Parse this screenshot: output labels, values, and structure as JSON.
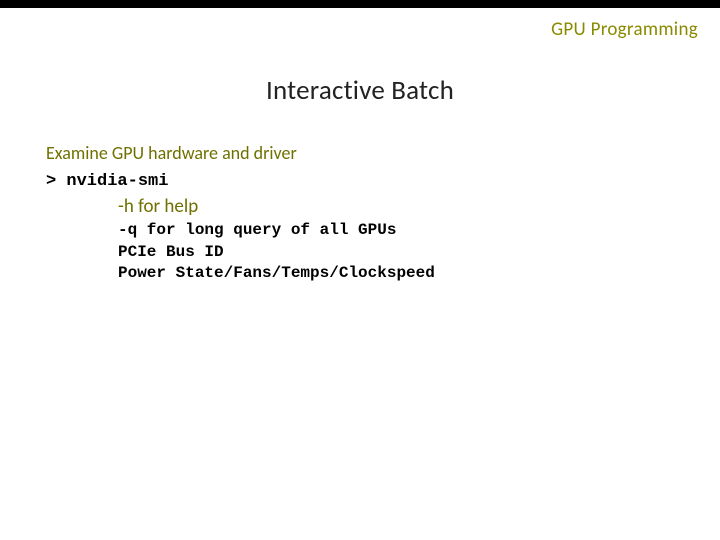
{
  "header": {
    "label": "GPU Programming"
  },
  "title": "Interactive Batch",
  "subtitle": "Examine GPU hardware and driver",
  "cmd": "> nvidia-smi",
  "helpline": "-h for help",
  "details": [
    "-q for long query of all GPUs",
    "PCIe Bus ID",
    "Power State/Fans/Temps/Clockspeed"
  ]
}
